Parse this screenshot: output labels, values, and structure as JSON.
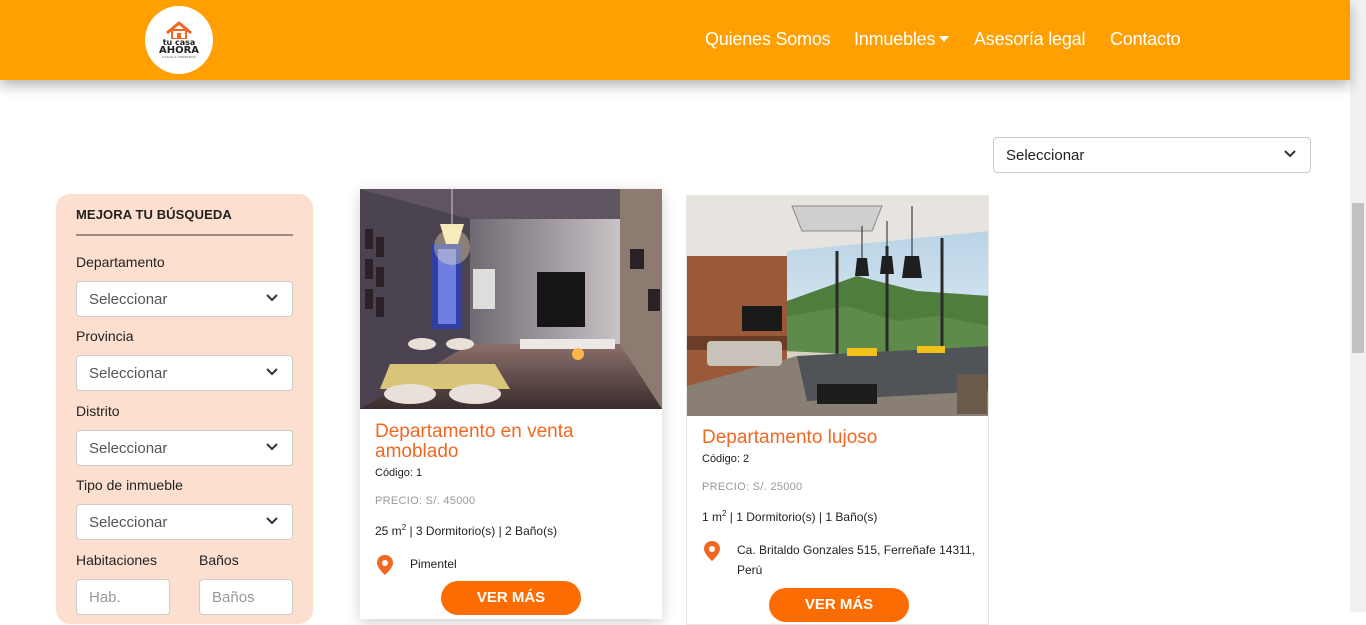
{
  "header": {
    "logo": {
      "line1": "tu casa",
      "line2": "AHORA",
      "tagline": "CASAS & TERRENOS"
    },
    "nav": [
      {
        "label": "Quienes Somos"
      },
      {
        "label": "Inmuebles"
      },
      {
        "label": "Asesoría legal"
      },
      {
        "label": "Contacto"
      }
    ]
  },
  "sort": {
    "value": "Seleccionar"
  },
  "sidebar": {
    "title": "MEJORA TU BÚSQUEDA",
    "departamento": {
      "label": "Departamento",
      "value": "Seleccionar"
    },
    "provincia": {
      "label": "Provincia",
      "value": "Seleccionar"
    },
    "distrito": {
      "label": "Distrito",
      "value": "Seleccionar"
    },
    "tipo": {
      "label": "Tipo de inmueble",
      "value": "Seleccionar"
    },
    "habitaciones": {
      "label": "Habitaciones",
      "placeholder": "Hab."
    },
    "banos": {
      "label": "Baños",
      "placeholder": "Baños"
    }
  },
  "listings": [
    {
      "title": "Departamento en venta amoblado",
      "code": "Código: 1",
      "price": "PRECIO: S/. 45000",
      "area": "25 m",
      "specs_rest": " | 3 Dormitorio(s) | 2 Baño(s)",
      "location": "Pimentel",
      "button": "VER MÁS"
    },
    {
      "title": "Departamento lujoso",
      "code": "Código: 2",
      "price": "PRECIO: S/. 25000",
      "area": "1 m",
      "specs_rest": " | 1 Dormitorio(s) | 1 Baño(s)",
      "location": "Ca. Britaldo Gonzales 515, Ferreñafe 14311, Perú",
      "button": "VER MÁS"
    }
  ],
  "colors": {
    "brand": "#ffa000",
    "accent": "#f26722",
    "button": "#fc6c00",
    "sidebar_bg": "#fddfcf"
  }
}
